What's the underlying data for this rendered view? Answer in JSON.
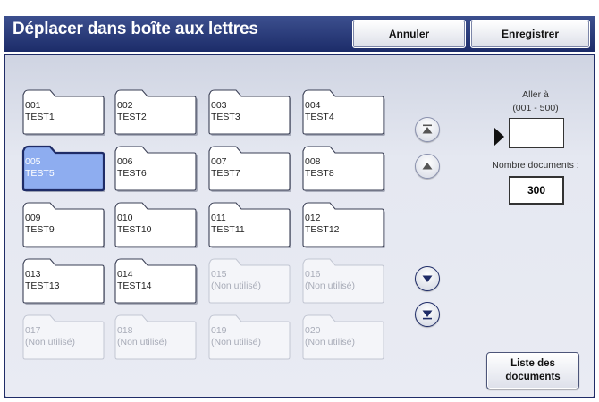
{
  "header": {
    "title": "Déplacer dans boîte aux lettres",
    "cancel_label": "Annuler",
    "save_label": "Enregistrer"
  },
  "folders": [
    {
      "number": "001",
      "name": "TEST1",
      "state": "used"
    },
    {
      "number": "002",
      "name": "TEST2",
      "state": "used"
    },
    {
      "number": "003",
      "name": "TEST3",
      "state": "used"
    },
    {
      "number": "004",
      "name": "TEST4",
      "state": "used"
    },
    {
      "number": "005",
      "name": "TEST5",
      "state": "selected"
    },
    {
      "number": "006",
      "name": "TEST6",
      "state": "used"
    },
    {
      "number": "007",
      "name": "TEST7",
      "state": "used"
    },
    {
      "number": "008",
      "name": "TEST8",
      "state": "used"
    },
    {
      "number": "009",
      "name": "TEST9",
      "state": "used"
    },
    {
      "number": "010",
      "name": "TEST10",
      "state": "used"
    },
    {
      "number": "011",
      "name": "TEST11",
      "state": "used"
    },
    {
      "number": "012",
      "name": "TEST12",
      "state": "used"
    },
    {
      "number": "013",
      "name": "TEST13",
      "state": "used"
    },
    {
      "number": "014",
      "name": "TEST14",
      "state": "used"
    },
    {
      "number": "015",
      "name": "(Non utilisé)",
      "state": "unused"
    },
    {
      "number": "016",
      "name": "(Non utilisé)",
      "state": "unused"
    },
    {
      "number": "017",
      "name": "(Non utilisé)",
      "state": "unused"
    },
    {
      "number": "018",
      "name": "(Non utilisé)",
      "state": "unused"
    },
    {
      "number": "019",
      "name": "(Non utilisé)",
      "state": "unused"
    },
    {
      "number": "020",
      "name": "(Non utilisé)",
      "state": "unused"
    }
  ],
  "scroll": {
    "top_icon": "scroll-to-top-icon",
    "up_icon": "scroll-up-icon",
    "down_icon": "scroll-down-icon",
    "bottom_icon": "scroll-to-bottom-icon"
  },
  "side": {
    "goto_label": "Aller à",
    "goto_range": "(001 - 500)",
    "goto_value": "",
    "doc_count_label": "Nombre documents :",
    "doc_count_value": "300",
    "doc_list_label": "Liste des\ndocuments"
  },
  "colors": {
    "title_bar": "#1c2c69",
    "selected_folder": "#8eadf0",
    "used_folder": "#ffffff",
    "unused_folder": "#f4f5f9"
  }
}
